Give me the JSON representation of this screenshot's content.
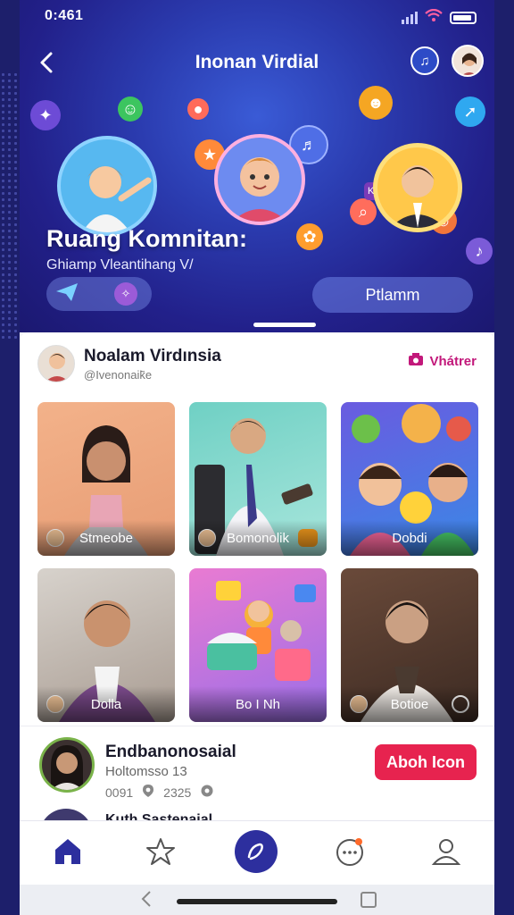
{
  "status": {
    "time": "0:461"
  },
  "header": {
    "title": "Inonan Virdial"
  },
  "hero": {
    "title": "Ruang Komnitan:",
    "subtitle": "Ghiamp Vleantihang V/",
    "action_label": "Ptlamm",
    "badge_text": "KVV"
  },
  "profile": {
    "name": "Noalam Virdınsia",
    "handle": "@Ivenonaik̃e",
    "watch_label": "Vhátrer"
  },
  "tiles": [
    {
      "label": "Stmeobe"
    },
    {
      "label": "Bomonolik"
    },
    {
      "label": "Dobdi"
    },
    {
      "label": "Dolla"
    },
    {
      "label": "Bo I Nh"
    },
    {
      "label": "Botioe"
    }
  ],
  "friend": {
    "name": "Endbanonosaial",
    "subtitle": "Holtomsso 13",
    "stat1": "0091",
    "stat2": "2325",
    "button_label": "Aboh Icon",
    "next_name": "Kuth Sastenaial"
  },
  "nav": {
    "items": [
      "home-icon",
      "star-icon",
      "edit-icon",
      "chat-icon",
      "profile-icon"
    ]
  },
  "colors": {
    "hero_bg": "#2b3cb0",
    "accent_pink": "#e7234f",
    "nav_active": "#2d2f9e",
    "watch_link": "#c2187a"
  }
}
